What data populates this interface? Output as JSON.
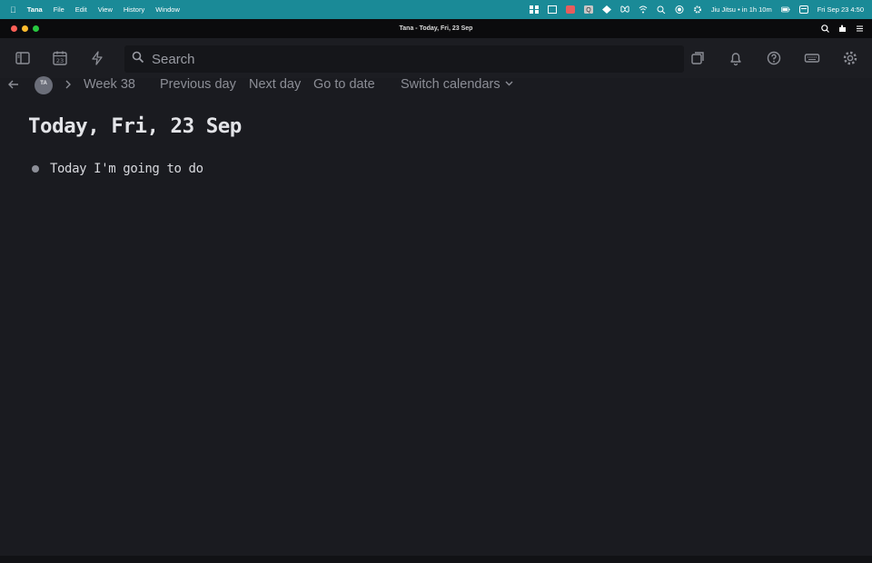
{
  "menubar": {
    "app_name": "Tana",
    "menus": [
      "File",
      "Edit",
      "View",
      "History",
      "Window"
    ],
    "event": "Jiu Jitsu • in 1h 10m",
    "datetime": "Fri Sep 23  4:50"
  },
  "window": {
    "title": "Tana - Today, Fri, 23 Sep"
  },
  "toolbar": {
    "search_placeholder": "Search"
  },
  "breadcrumb": {
    "avatar_initials": "TA",
    "week": "Week 38",
    "previous_day": "Previous day",
    "next_day": "Next day",
    "go_to_date": "Go to date",
    "switch_calendars": "Switch calendars"
  },
  "page": {
    "title": "Today, Fri, 23 Sep",
    "nodes": [
      {
        "text": "Today I'm going to do"
      }
    ]
  },
  "colors": {
    "menubar": "#1a8a97",
    "background": "#1a1b20",
    "toolbar": "#1c1d22",
    "search": "#15161a"
  }
}
